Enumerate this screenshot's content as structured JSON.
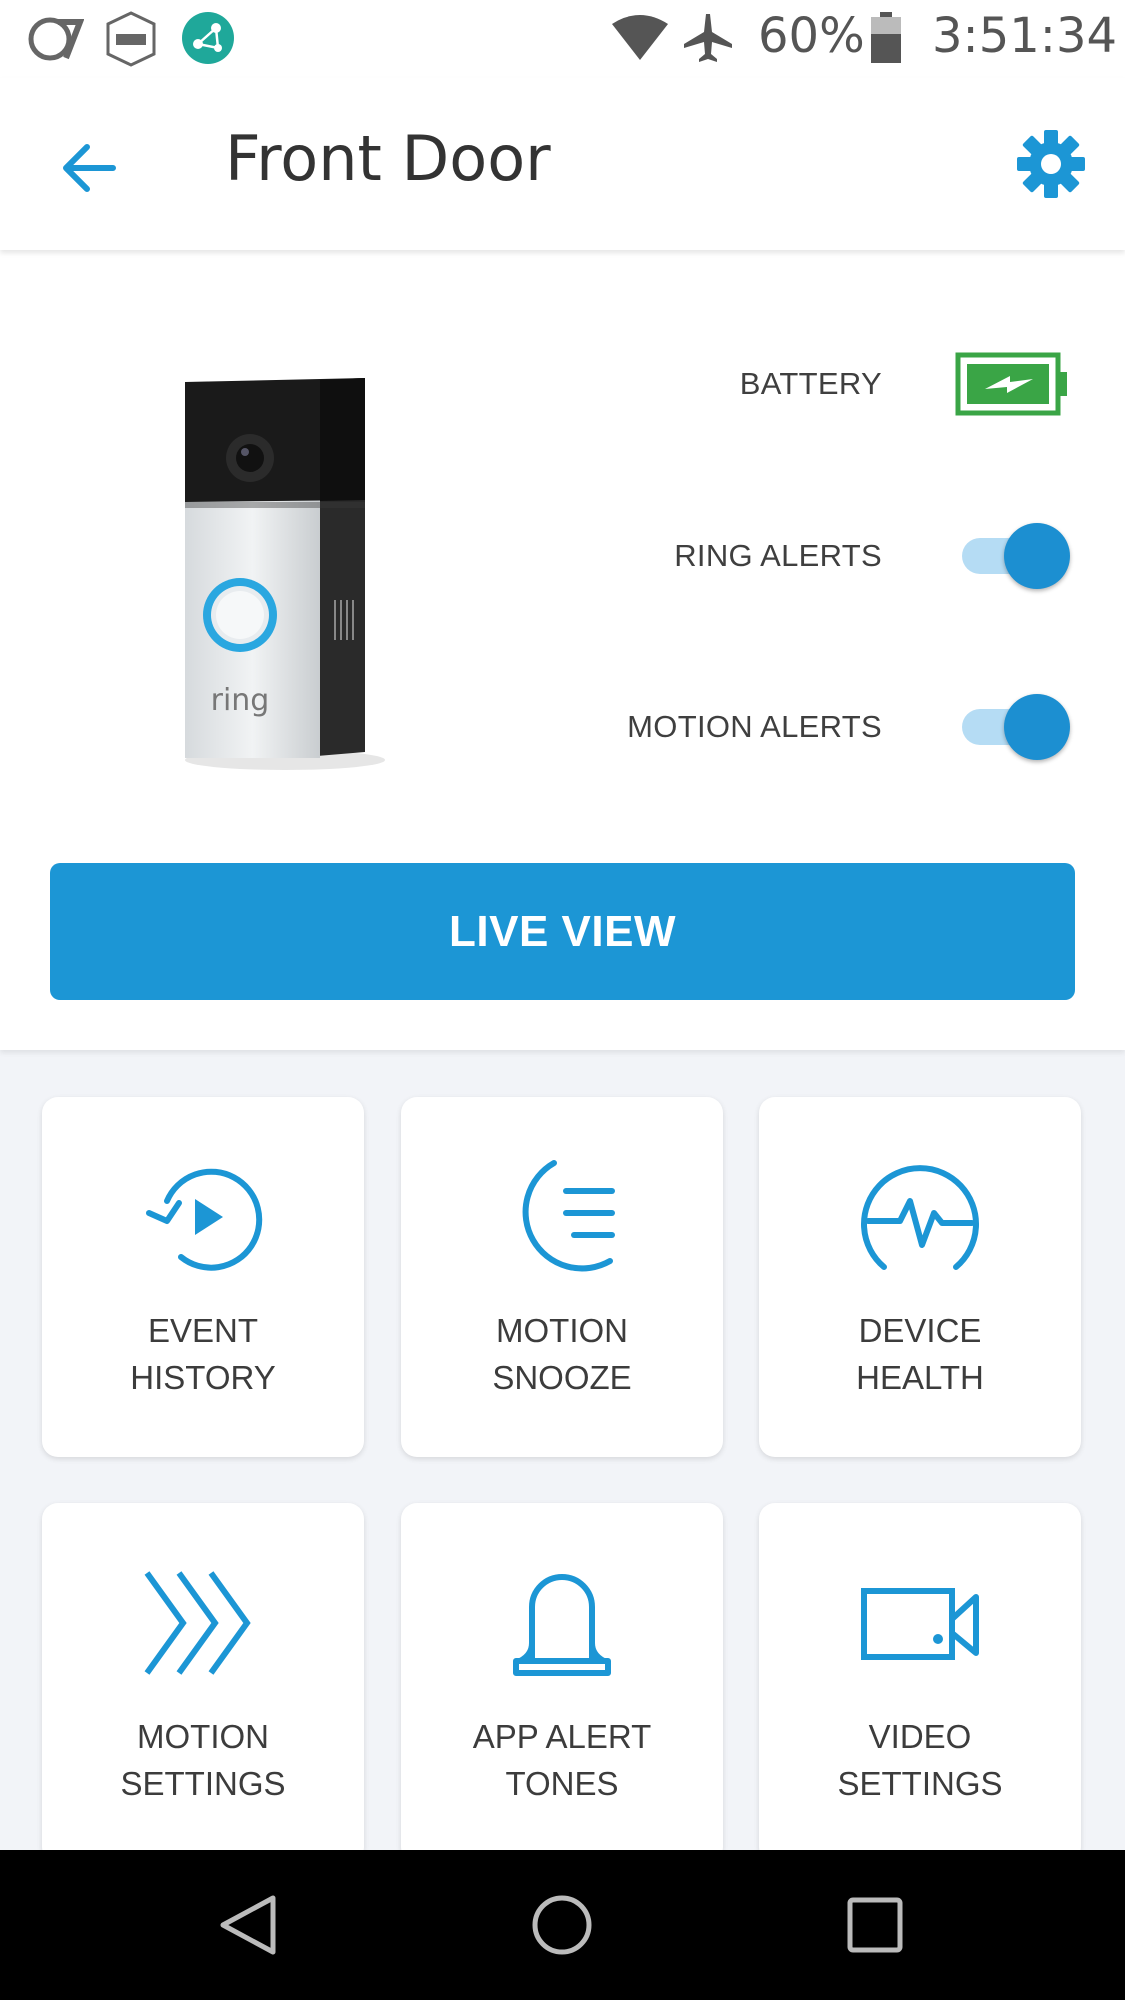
{
  "status_bar": {
    "battery_percent": "60%",
    "time": "3:51:34",
    "notification_icons": [
      "abc7-icon",
      "adt-icon",
      "network-app-icon"
    ],
    "system_icons": [
      "wifi-icon",
      "airplane-mode-icon",
      "battery-icon"
    ]
  },
  "header": {
    "title": "Front Door",
    "back_icon": "back-arrow-icon",
    "settings_icon": "gear-icon"
  },
  "device": {
    "image": "ring-doorbell",
    "brand_text": "ring",
    "battery_label": "BATTERY",
    "battery_state": "charging",
    "ring_alerts_label": "RING ALERTS",
    "ring_alerts_on": true,
    "motion_alerts_label": "MOTION ALERTS",
    "motion_alerts_on": true
  },
  "live_view_label": "LIVE VIEW",
  "tiles": [
    {
      "icon": "event-history-icon",
      "line1": "EVENT",
      "line2": "HISTORY"
    },
    {
      "icon": "motion-snooze-icon",
      "line1": "MOTION",
      "line2": "SNOOZE"
    },
    {
      "icon": "device-health-icon",
      "line1": "DEVICE",
      "line2": "HEALTH"
    },
    {
      "icon": "motion-settings-icon",
      "line1": "MOTION",
      "line2": "SETTINGS"
    },
    {
      "icon": "bell-icon",
      "line1": "APP ALERT",
      "line2": "TONES"
    },
    {
      "icon": "video-camera-icon",
      "line1": "VIDEO",
      "line2": "SETTINGS"
    }
  ],
  "colors": {
    "accent": "#1c96d5",
    "battery_green": "#3aa546",
    "toggle_track": "#b5dcf4",
    "background": "#f2f4f8"
  },
  "nav_bar": [
    "nav-back-icon",
    "nav-home-icon",
    "nav-recents-icon"
  ]
}
